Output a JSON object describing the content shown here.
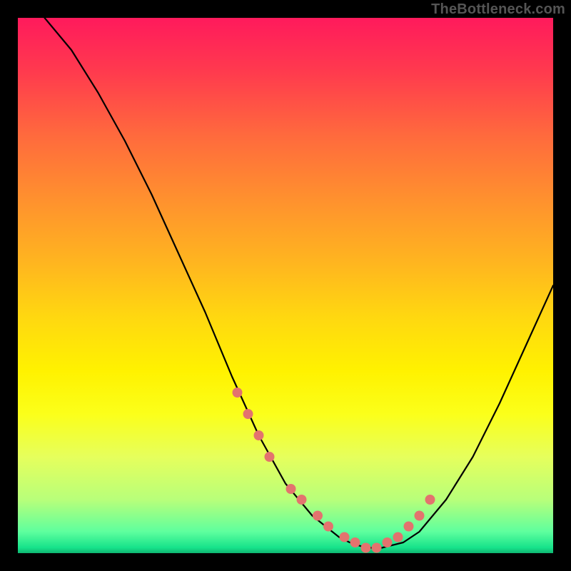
{
  "watermark": "TheBottleneck.com",
  "chart_data": {
    "type": "line",
    "title": "",
    "xlabel": "",
    "ylabel": "",
    "xlim": [
      0,
      100
    ],
    "ylim": [
      0,
      100
    ],
    "series": [
      {
        "name": "bottleneck-curve",
        "x": [
          5,
          10,
          15,
          20,
          25,
          30,
          35,
          40,
          45,
          50,
          55,
          60,
          62,
          65,
          68,
          72,
          75,
          80,
          85,
          90,
          95,
          100
        ],
        "y": [
          100,
          94,
          86,
          77,
          67,
          56,
          45,
          33,
          22,
          13,
          7,
          3,
          2,
          1,
          1,
          2,
          4,
          10,
          18,
          28,
          39,
          50
        ]
      }
    ],
    "markers": {
      "name": "highlight-dots",
      "color": "#e3736e",
      "x": [
        41,
        43,
        45,
        47,
        51,
        53,
        56,
        58,
        61,
        63,
        65,
        67,
        69,
        71,
        73,
        75,
        77
      ],
      "y": [
        30,
        26,
        22,
        18,
        12,
        10,
        7,
        5,
        3,
        2,
        1,
        1,
        2,
        3,
        5,
        7,
        10
      ]
    }
  }
}
